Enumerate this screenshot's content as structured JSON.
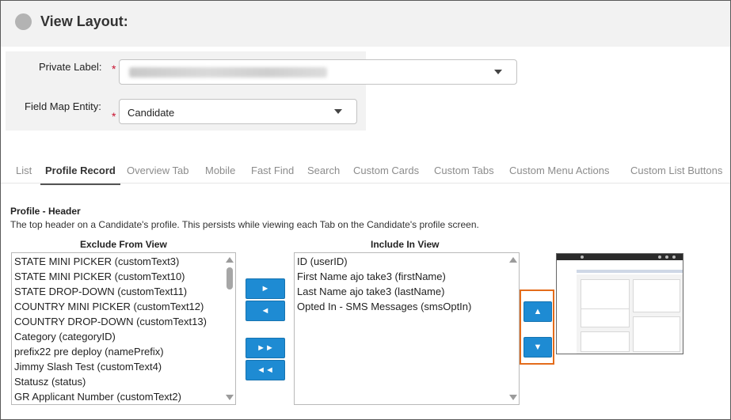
{
  "header": {
    "title": "View Layout:"
  },
  "form": {
    "private_label": {
      "label": "Private Label:",
      "required_mark": "*"
    },
    "field_map_entity": {
      "label": "Field Map Entity:",
      "required_mark": "*",
      "value": "Candidate"
    }
  },
  "tabs": [
    {
      "label": "List"
    },
    {
      "label": "Profile Record",
      "active": true
    },
    {
      "label": "Overview Tab"
    },
    {
      "label": "Mobile"
    },
    {
      "label": "Fast Find"
    },
    {
      "label": "Search"
    },
    {
      "label": "Custom Cards"
    },
    {
      "label": "Custom Tabs"
    },
    {
      "label": "Custom Menu Actions"
    },
    {
      "label": "Custom List Buttons"
    }
  ],
  "section": {
    "title": "Profile - Header",
    "description": "The top header on a Candidate's profile. This persists while viewing each Tab on the Candidate's profile screen."
  },
  "exclude": {
    "heading": "Exclude From View",
    "items": [
      "STATE MINI PICKER (customText3)",
      "STATE MINI PICKER (customText10)",
      "STATE DROP-DOWN (customText11)",
      "COUNTRY MINI PICKER (customText12)",
      "COUNTRY DROP-DOWN (customText13)",
      "Category (categoryID)",
      "prefix22 pre deploy (namePrefix)",
      "Jimmy Slash Test (customText4)",
      "Statusz (status)",
      "GR Applicant Number (customText2)"
    ]
  },
  "include": {
    "heading": "Include In View",
    "items": [
      "ID (userID)",
      "First Name ajo take3 (firstName)",
      "Last Name ajo take3 (lastName)",
      "Opted In - SMS Messages (smsOptIn)"
    ]
  },
  "buttons": {
    "move_right": "►",
    "move_left": "◄",
    "move_all_right": "►►",
    "move_all_left": "◄◄",
    "move_up": "▲",
    "move_down": "▼"
  },
  "colors": {
    "accent": "#1e8bd3",
    "highlight": "#e46c1b",
    "required": "#c8102e"
  }
}
